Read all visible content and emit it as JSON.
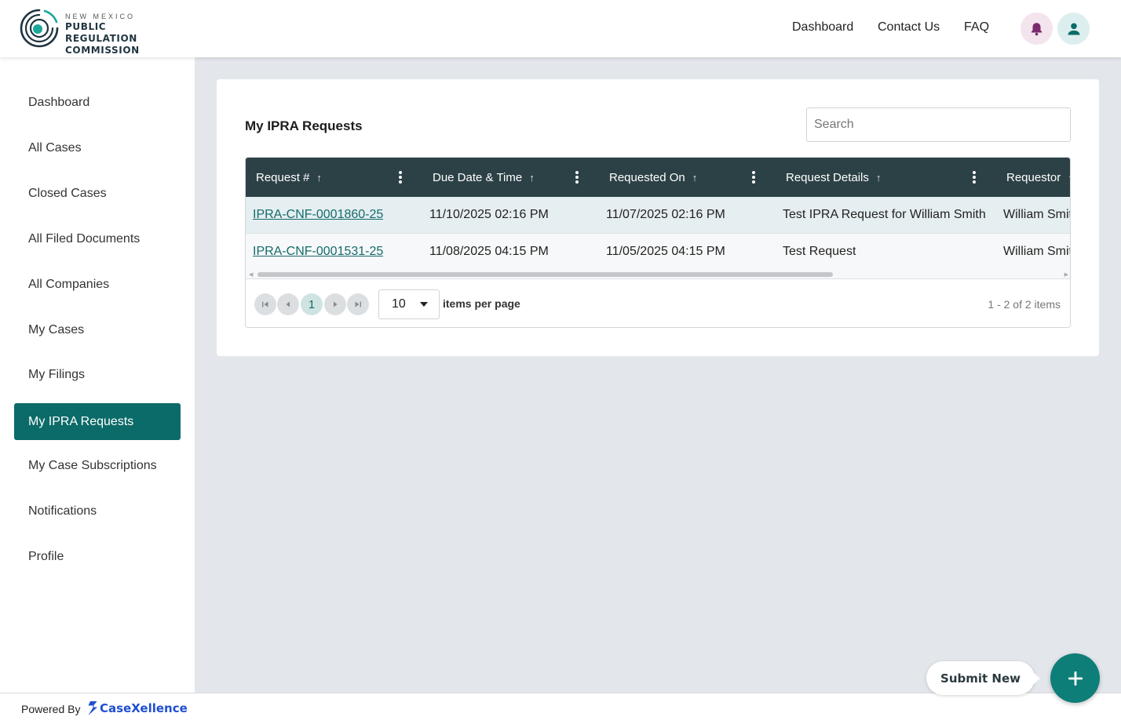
{
  "header": {
    "logo_line1": "NEW MEXICO",
    "logo_line2": "PUBLIC REGULATION",
    "logo_line3": "COMMISSION",
    "nav": [
      "Dashboard",
      "Contact Us",
      "FAQ"
    ],
    "notification_icon": "bell-icon",
    "profile_icon": "user-icon",
    "colors": {
      "bell_bg": "#f3e4ee",
      "bell": "#7a2b6d",
      "user_bg": "#dcefee",
      "user": "#0b6b68"
    }
  },
  "sidebar": {
    "items": [
      {
        "label": "Dashboard",
        "active": false
      },
      {
        "label": "All Cases",
        "active": false
      },
      {
        "label": "Closed Cases",
        "active": false
      },
      {
        "label": "All Filed Documents",
        "active": false
      },
      {
        "label": "All Companies",
        "active": false
      },
      {
        "label": "My Cases",
        "active": false
      },
      {
        "label": "My Filings",
        "active": false
      },
      {
        "label": "My IPRA Requests",
        "active": true
      },
      {
        "label": "My Case Subscriptions",
        "active": false
      },
      {
        "label": "Notifications",
        "active": false
      },
      {
        "label": "Profile",
        "active": false
      }
    ],
    "accent": "#0b6b68"
  },
  "main": {
    "title": "My IPRA Requests",
    "search_placeholder": "Search",
    "table": {
      "columns": [
        "Request #",
        "Due Date & Time",
        "Requested On",
        "Request Details",
        "Requestor"
      ],
      "sort_icon": "arrow-up-icon",
      "menu_icon": "kebab-menu-icon",
      "rows": [
        [
          "IPRA-CNF-0001860-25",
          "11/10/2025 02:16 PM",
          "11/07/2025 02:16 PM",
          "Test IPRA Request for William Smith",
          "William Smith"
        ],
        [
          "IPRA-CNF-0001531-25",
          "11/08/2025 04:15 PM",
          "11/05/2025 04:15 PM",
          "Test Request",
          "William Smith"
        ]
      ],
      "header_color": "#2c4146"
    },
    "pager": {
      "current_page": "1",
      "page_size": "10",
      "page_size_label": "items per page",
      "info": "1 - 2 of 2 items"
    }
  },
  "footer": {
    "powered_by": "Powered By",
    "brand": "CaseXellence",
    "brand_color": "#1f4fd1"
  },
  "actions": {
    "submit_label": "Submit New",
    "add_icon": "plus-icon",
    "fab_color": "#0e7e78"
  }
}
